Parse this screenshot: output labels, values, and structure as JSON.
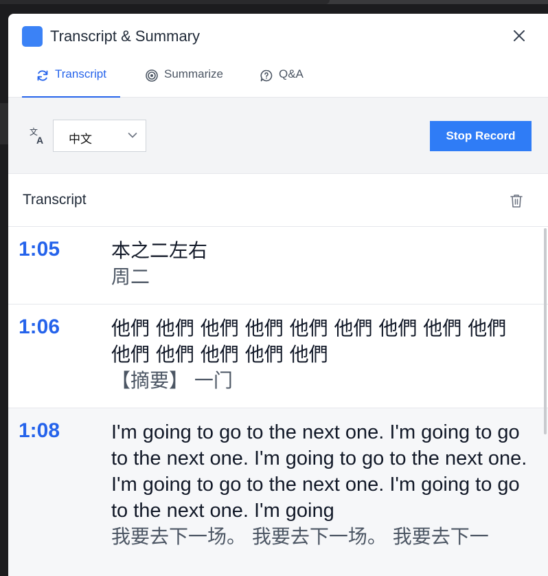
{
  "panel": {
    "title": "Transcript & Summary"
  },
  "tabs": [
    {
      "label": "Transcript",
      "icon": "refresh-icon",
      "active": true
    },
    {
      "label": "Summarize",
      "icon": "target-icon",
      "active": false
    },
    {
      "label": "Q&A",
      "icon": "chat-question-icon",
      "active": false
    }
  ],
  "toolbar": {
    "language": "中文",
    "stop_label": "Stop Record"
  },
  "section": {
    "title": "Transcript"
  },
  "entries": [
    {
      "time": "1:05",
      "text": "本之二左右",
      "translation": "周二"
    },
    {
      "time": "1:06",
      "text": "他們 他們 他們 他們 他們 他們 他們 他們 他們 他們 他們 他們 他們 他們",
      "translation": "【摘要】 一门"
    },
    {
      "time": "1:08",
      "text": "I'm going to go to the next one. I'm going to go to the next one. I'm going to go to the next one. I'm going to go to the next one. I'm going to go to the next one. I'm going",
      "translation": "我要去下一场。 我要去下一场。 我要去下一"
    }
  ],
  "colors": {
    "accent": "#2563eb",
    "button": "#2f7cf6"
  }
}
